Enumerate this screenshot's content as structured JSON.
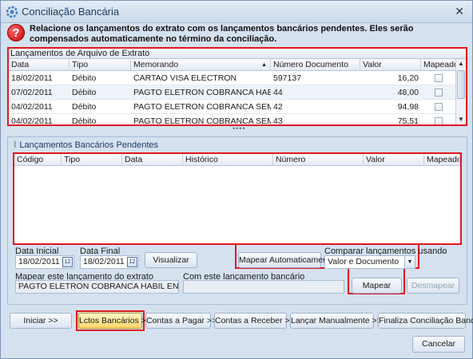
{
  "window": {
    "title": "Conciliação Bancária",
    "close_glyph": "✕"
  },
  "info": {
    "icon_glyph": "?",
    "message": "Relacione os lançamentos do extrato com os lançamentos bancários pendentes. Eles serão compensados automaticamente no término da conciliação."
  },
  "extrato": {
    "title": "Lançamentos de Arquivo de Extrato",
    "columns": [
      "Data",
      "Tipo",
      "Memorando",
      "Número Documento",
      "Valor",
      "Mapeado"
    ],
    "sort_glyph": "▲",
    "rows": [
      {
        "data": "18/02/2011",
        "tipo": "Débito",
        "memorando": "CARTAO VISA ELECTRON",
        "numero": "597137",
        "valor": "16,20",
        "mapeado": false
      },
      {
        "data": "07/02/2011",
        "tipo": "Débito",
        "memorando": "PAGTO ELETRON  COBRANCA HABIL ENTERP...",
        "numero": "44",
        "valor": "48,00",
        "mapeado": false
      },
      {
        "data": "04/02/2011",
        "tipo": "Débito",
        "memorando": "PAGTO ELETRON  COBRANCA SEMPARAR D...",
        "numero": "42",
        "valor": "94,98",
        "mapeado": false
      },
      {
        "data": "04/02/2011",
        "tipo": "Débito",
        "memorando": "PAGTO ELETRON  COBRANCA SEMPARAR J...",
        "numero": "43",
        "valor": "75,51",
        "mapeado": false
      }
    ]
  },
  "splitter_glyph": "••••",
  "pendentes": {
    "title": "Lançamentos Bancários Pendentes",
    "pin_glyph": "⌇",
    "columns": [
      "Código",
      "Tipo",
      "Data",
      "Histórico",
      "Número",
      "Valor",
      "Mapeado"
    ]
  },
  "filters": {
    "data_inicial_label": "Data Inicial",
    "data_inicial_value": "18/02/2011",
    "data_final_label": "Data Final",
    "data_final_value": "18/02/2011",
    "calendar_glyph": "12",
    "visualizar_label": "Visualizar",
    "mapear_auto_label": "Mapear Automaticamente",
    "comparar_label": "Comparar lançamentos usando",
    "comparar_value": "Valor e Documento",
    "combo_arrow": "▼"
  },
  "mapping": {
    "extrato_label": "Mapear este lançamento do extrato",
    "extrato_value": "PAGTO ELETRON  COBRANCA HABIL ENTERPRISE",
    "bancario_label": "Com este lançamento bancário",
    "bancario_value": "",
    "mapear_label": "Mapear",
    "desmapear_label": "Desmapear"
  },
  "footer": {
    "iniciar": "Iniciar >>",
    "lctos": "Lctos Bancários >>",
    "pagar": "Contas a Pagar >>",
    "receber": "Contas a Receber >>",
    "manual": "Lançar Manualmente >>",
    "finalizar": "Finaliza Conciliação Bancária",
    "cancelar": "Cancelar"
  }
}
